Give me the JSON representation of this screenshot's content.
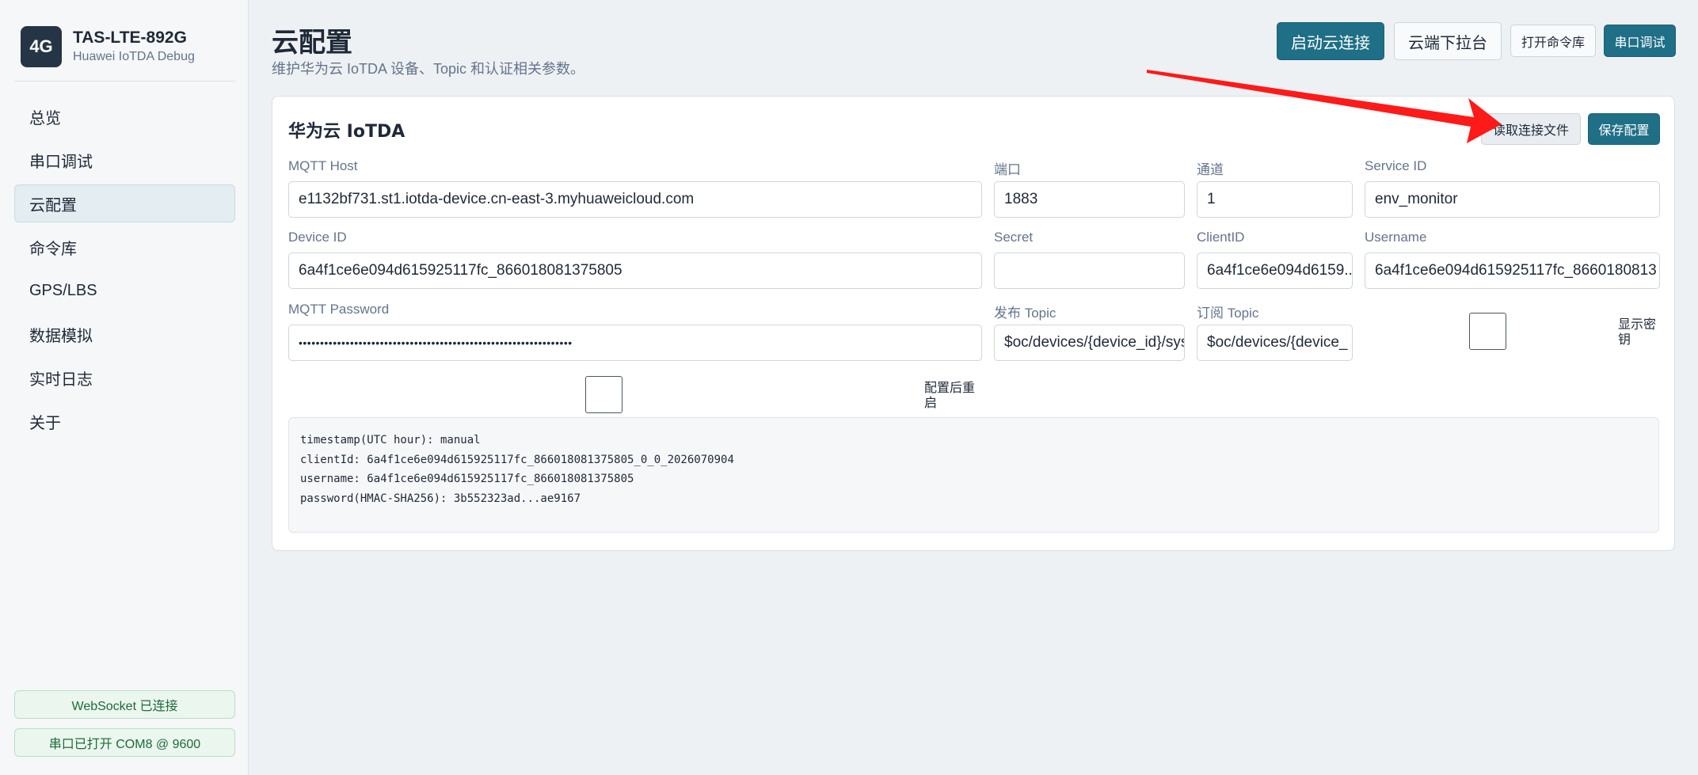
{
  "sidebar": {
    "brand": {
      "logo": "4G",
      "title": "TAS-LTE-892G",
      "subtitle": "Huawei IoTDA Debug"
    },
    "items": [
      {
        "label": "总览",
        "active": false
      },
      {
        "label": "串口调试",
        "active": false
      },
      {
        "label": "云配置",
        "active": true
      },
      {
        "label": "命令库",
        "active": false
      },
      {
        "label": "GPS/LBS",
        "active": false
      },
      {
        "label": "数据模拟",
        "active": false
      },
      {
        "label": "实时日志",
        "active": false
      },
      {
        "label": "关于",
        "active": false
      }
    ],
    "status": {
      "websocket": "WebSocket 已连接",
      "serial": "串口已打开 COM8 @ 9600"
    }
  },
  "header": {
    "title": "云配置",
    "subtitle": "维护华为云 IoTDA 设备、Topic 和认证相关参数。",
    "buttons": {
      "start_cloud": "启动云连接",
      "cloud_dropdown": "云端下拉台",
      "open_commands": "打开命令库",
      "serial_debug": "串口调试"
    }
  },
  "card": {
    "title": "华为云 IoTDA",
    "buttons": {
      "read_file": "读取连接文件",
      "save": "保存配置"
    },
    "fields": {
      "mqtt_host": {
        "label": "MQTT Host",
        "value": "e1132bf731.st1.iotda-device.cn-east-3.myhuaweicloud.com"
      },
      "port": {
        "label": "端口",
        "value": "1883"
      },
      "channel": {
        "label": "通道",
        "value": "1"
      },
      "service_id": {
        "label": "Service ID",
        "value": "env_monitor"
      },
      "device_id": {
        "label": "Device ID",
        "value": "6a4f1ce6e094d615925117fc_866018081375805"
      },
      "secret": {
        "label": "Secret",
        "value": ""
      },
      "client_id": {
        "label": "ClientID",
        "value": "6a4f1ce6e094d6159..."
      },
      "username": {
        "label": "Username",
        "value": "6a4f1ce6e094d615925117fc_8660180813"
      },
      "mqtt_password": {
        "label": "MQTT Password",
        "value": "••••••••••••••••••••••••••••••••••••••••••••••••••••••••••••••••"
      },
      "publish_topic": {
        "label": "发布 Topic",
        "value": "$oc/devices/{device_id}/sys"
      },
      "subscribe_topic": {
        "label": "订阅 Topic",
        "value": "$oc/devices/{device_"
      }
    },
    "checkboxes": {
      "show_secret": {
        "label": "显示密钥",
        "checked": false
      },
      "restart_after": {
        "label": "配置后重启",
        "checked": false
      }
    },
    "preview_lines": [
      "timestamp(UTC hour): manual",
      "clientId: 6a4f1ce6e094d615925117fc_866018081375805_0_0_2026070904",
      "username: 6a4f1ce6e094d615925117fc_866018081375805",
      "password(HMAC-SHA256): 3b552323ad...ae9167"
    ]
  },
  "annotation": {
    "arrow_color": "#ff1a1a"
  }
}
